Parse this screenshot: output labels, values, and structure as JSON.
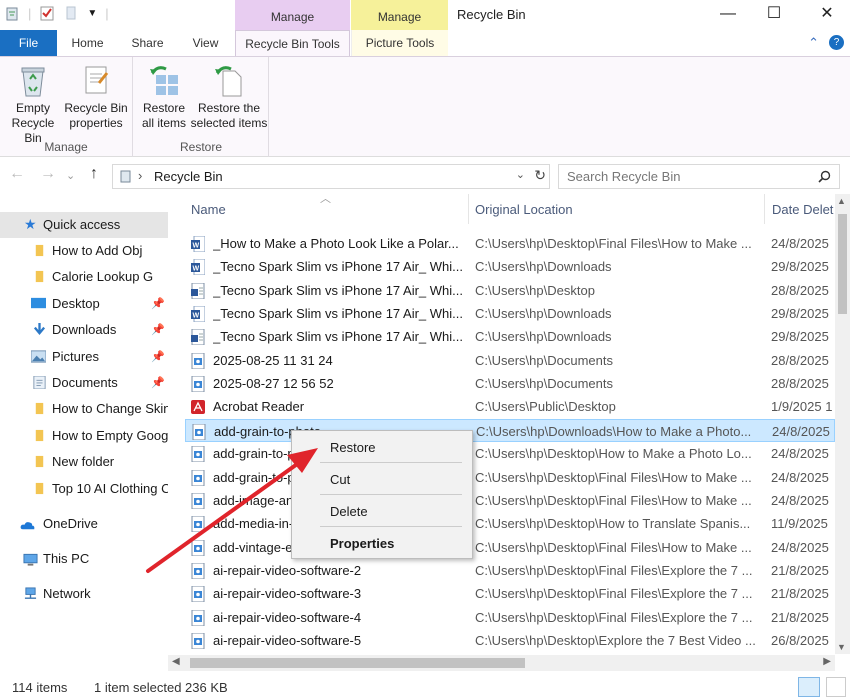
{
  "window": {
    "title": "Recycle Bin",
    "context_tab_manage_1": "Manage",
    "context_tab_manage_2": "Manage",
    "minimize": "—",
    "maximize": "☐",
    "close": "✕"
  },
  "ribbon_tabs": {
    "file": "File",
    "home": "Home",
    "share": "Share",
    "view": "View",
    "recycle_bin_tools": "Recycle Bin Tools",
    "picture_tools": "Picture Tools"
  },
  "ribbon": {
    "empty_recycle_bin": [
      "Empty",
      "Recycle Bin"
    ],
    "recycle_bin_properties": [
      "Recycle Bin",
      "properties"
    ],
    "manage_group": "Manage",
    "restore_all": [
      "Restore",
      "all items"
    ],
    "restore_selected": [
      "Restore the",
      "selected items"
    ],
    "restore_group": "Restore"
  },
  "address": {
    "path": "Recycle Bin",
    "search_placeholder": "Search Recycle Bin"
  },
  "sidebar": {
    "quick_access": "Quick access",
    "items": [
      {
        "label": "How to Add Obj",
        "type": "folder"
      },
      {
        "label": "Calorie Lookup G",
        "type": "folder"
      },
      {
        "label": "Desktop",
        "type": "desktop"
      },
      {
        "label": "Downloads",
        "type": "downloads"
      },
      {
        "label": "Pictures",
        "type": "pictures"
      },
      {
        "label": "Documents",
        "type": "documents"
      },
      {
        "label": "How to Change Skin",
        "type": "folder"
      },
      {
        "label": "How to Empty Goog",
        "type": "folder"
      },
      {
        "label": "New folder",
        "type": "folder"
      },
      {
        "label": "Top 10 AI Clothing C",
        "type": "folder"
      }
    ],
    "onedrive": "OneDrive",
    "this_pc": "This PC",
    "network": "Network"
  },
  "columns": {
    "name": "Name",
    "original_location": "Original Location",
    "date_deleted": "Date Delet"
  },
  "files": [
    {
      "name": "_How to Make a Photo Look Like a Polar...",
      "location": "C:\\Users\\hp\\Desktop\\Final Files\\How to Make ...",
      "date": "24/8/2025",
      "icon": "word"
    },
    {
      "name": "_Tecno Spark Slim vs iPhone 17 Air_ Whi...",
      "location": "C:\\Users\\hp\\Downloads",
      "date": "29/8/2025",
      "icon": "word"
    },
    {
      "name": "_Tecno Spark Slim vs iPhone 17 Air_ Whi...",
      "location": "C:\\Users\\hp\\Desktop",
      "date": "28/8/2025",
      "icon": "word-doc"
    },
    {
      "name": "_Tecno Spark Slim vs iPhone 17 Air_ Whi...",
      "location": "C:\\Users\\hp\\Downloads",
      "date": "29/8/2025",
      "icon": "word"
    },
    {
      "name": "_Tecno Spark Slim vs iPhone 17 Air_ Whi...",
      "location": "C:\\Users\\hp\\Downloads",
      "date": "29/8/2025",
      "icon": "word-doc"
    },
    {
      "name": "2025-08-25 11 31 24",
      "location": "C:\\Users\\hp\\Documents",
      "date": "28/8/2025",
      "icon": "image"
    },
    {
      "name": "2025-08-27 12 56 52",
      "location": "C:\\Users\\hp\\Documents",
      "date": "28/8/2025",
      "icon": "image"
    },
    {
      "name": "Acrobat Reader",
      "location": "C:\\Users\\Public\\Desktop",
      "date": "1/9/2025 1",
      "icon": "acrobat"
    },
    {
      "name": "add-grain-to-photo",
      "location": "C:\\Users\\hp\\Downloads\\How to Make a Photo...",
      "date": "24/8/2025",
      "icon": "image",
      "selected": true
    },
    {
      "name": "add-grain-to-photo",
      "location": "C:\\Users\\hp\\Desktop\\How to Make a Photo Lo...",
      "date": "24/8/2025",
      "icon": "image"
    },
    {
      "name": "add-grain-to-photo",
      "location": "C:\\Users\\hp\\Desktop\\Final Files\\How to Make ...",
      "date": "24/8/2025",
      "icon": "image"
    },
    {
      "name": "add-image-and-text",
      "location": "C:\\Users\\hp\\Desktop\\Final Files\\How to Make ...",
      "date": "24/8/2025",
      "icon": "image"
    },
    {
      "name": "add-media-in-video",
      "location": "C:\\Users\\hp\\Desktop\\How to Translate Spanis...",
      "date": "11/9/2025",
      "icon": "image"
    },
    {
      "name": "add-vintage-effect",
      "location": "C:\\Users\\hp\\Desktop\\Final Files\\How to Make ...",
      "date": "24/8/2025",
      "icon": "image"
    },
    {
      "name": "ai-repair-video-software-2",
      "location": "C:\\Users\\hp\\Desktop\\Final Files\\Explore the 7 ...",
      "date": "21/8/2025",
      "icon": "image"
    },
    {
      "name": "ai-repair-video-software-3",
      "location": "C:\\Users\\hp\\Desktop\\Final Files\\Explore the 7 ...",
      "date": "21/8/2025",
      "icon": "image"
    },
    {
      "name": "ai-repair-video-software-4",
      "location": "C:\\Users\\hp\\Desktop\\Final Files\\Explore the 7 ...",
      "date": "21/8/2025",
      "icon": "image"
    },
    {
      "name": "ai-repair-video-software-5",
      "location": "C:\\Users\\hp\\Desktop\\Explore the 7 Best Video ...",
      "date": "26/8/2025",
      "icon": "image"
    }
  ],
  "context_menu": {
    "restore": "Restore",
    "cut": "Cut",
    "delete": "Delete",
    "properties": "Properties"
  },
  "status": {
    "count": "114 items",
    "selection": "1 item selected  236 KB"
  },
  "colors": {
    "file_tab": "#1a6fc2",
    "manage_purple": "#e8cdf1",
    "manage_yellow": "#f6f19a",
    "selection": "#cce8ff",
    "arrow": "#e0242b"
  }
}
